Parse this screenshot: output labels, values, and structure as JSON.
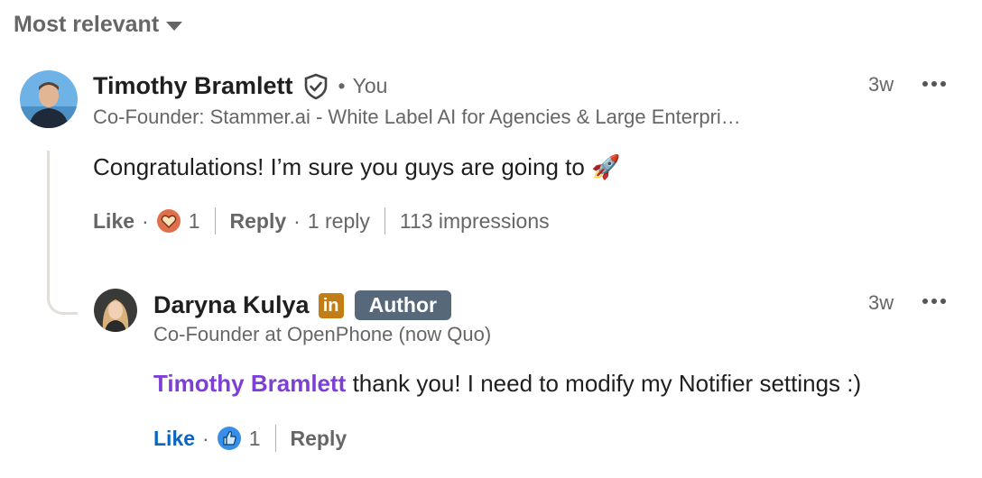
{
  "sort": {
    "label": "Most relevant"
  },
  "comment": {
    "author": "Timothy Bramlett",
    "you_label": "You",
    "headline": "Co-Founder: Stammer.ai - White Label AI for Agencies & Large Enterpri…",
    "time": "3w",
    "text": "Congratulations! I’m sure you guys are going to 🚀",
    "actions": {
      "like": "Like",
      "reaction_count": "1",
      "reply": "Reply",
      "replies": "1 reply",
      "impressions": "113 impressions"
    }
  },
  "reply": {
    "author": "Daryna Kulya",
    "badge": "Author",
    "headline": "Co-Founder at OpenPhone (now Quo)",
    "time": "3w",
    "mention": "Timothy Bramlett",
    "text": " thank you! I need to modify my Notifier settings :)",
    "actions": {
      "like": "Like",
      "reaction_count": "1",
      "reply": "Reply"
    }
  },
  "colors": {
    "accent_like": "#0a66c2",
    "mention": "#7e3fd6",
    "badge_bg": "#56687a",
    "linkedin_premium": "#c37d16"
  },
  "icons": [
    "verified-shield-icon",
    "heart-reaction-icon",
    "like-reaction-icon",
    "linkedin-premium-icon",
    "more-options-icon",
    "caret-down-icon"
  ]
}
